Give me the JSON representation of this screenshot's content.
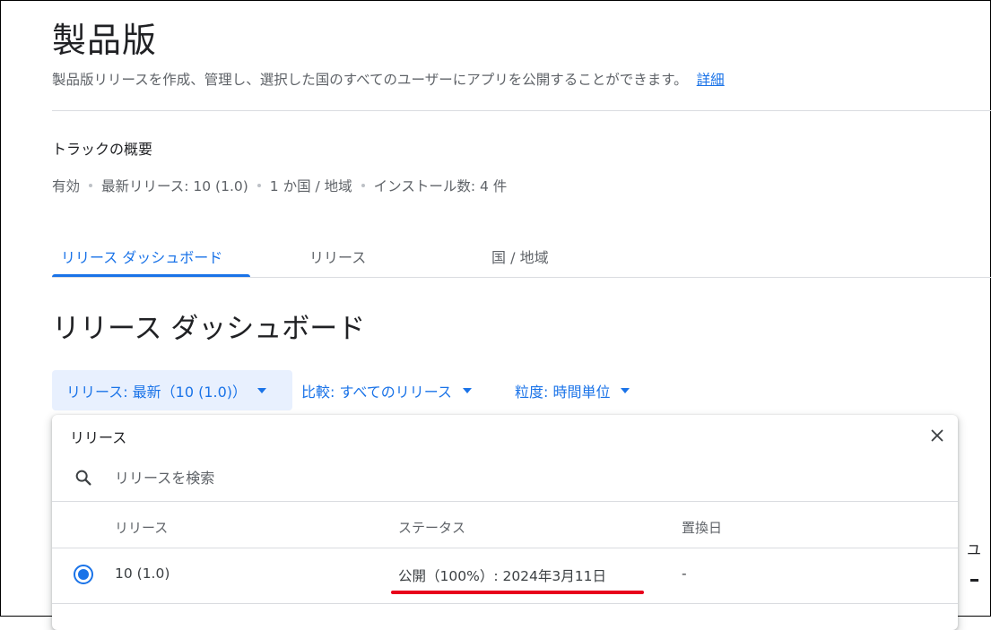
{
  "header": {
    "title": "製品版",
    "description": "製品版リリースを作成、管理し、選択した国のすべてのユーザーにアプリを公開することができます。",
    "link_label": "詳細"
  },
  "overview": {
    "title": "トラックの概要",
    "items": [
      "有効",
      "最新リリース: 10 (1.0)",
      "1 か国 / 地域",
      "インストール数: 4 件"
    ]
  },
  "tabs": [
    {
      "label": "リリース ダッシュボード",
      "active": true
    },
    {
      "label": "リリース",
      "active": false
    },
    {
      "label": "国 / 地域",
      "active": false
    }
  ],
  "section": {
    "title": "リリース ダッシュボード"
  },
  "filters": {
    "release": "リリース: 最新（10 (1.0)）",
    "compare": "比較: すべてのリリース",
    "granularity": "粒度: 時間単位"
  },
  "release_panel": {
    "title": "リリース",
    "search_placeholder": "リリースを検索",
    "columns": [
      "リリース",
      "ステータス",
      "置換日"
    ],
    "rows": [
      {
        "release": "10 (1.0)",
        "status": "公開（100%）: 2024年3月11日",
        "replaced": "-",
        "selected": true
      }
    ]
  },
  "edge": {
    "text": "ユ"
  },
  "colors": {
    "accent": "#1a73e8",
    "chip_bg": "#e8f0fe",
    "annotation_underline": "#e8001c"
  }
}
